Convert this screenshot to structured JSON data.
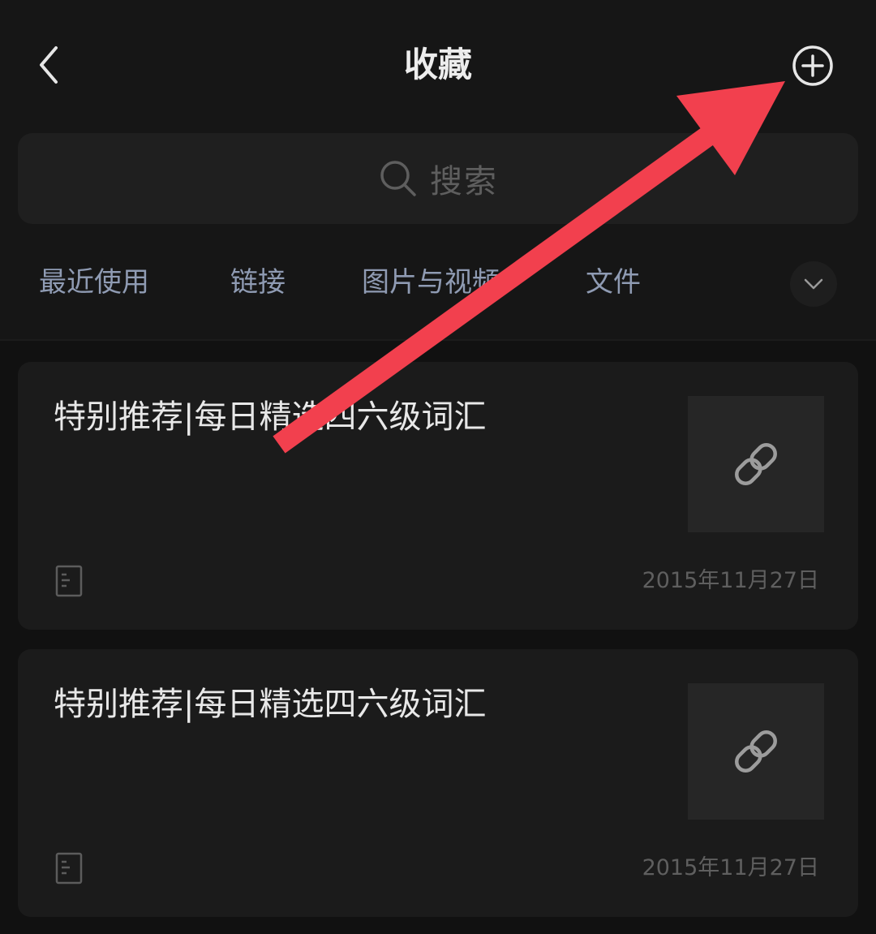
{
  "header": {
    "title": "收藏",
    "back_icon": "chevron-left-icon",
    "add_icon": "plus-circle-icon"
  },
  "search": {
    "placeholder": "搜索",
    "icon": "search-icon"
  },
  "filters": {
    "items": [
      {
        "label": "最近使用"
      },
      {
        "label": "链接"
      },
      {
        "label": "图片与视频"
      },
      {
        "label": "文件"
      }
    ],
    "expand_icon": "chevron-down-icon"
  },
  "cards": [
    {
      "title": "特别推荐|每日精选四六级词汇",
      "date": "2015年11月27日",
      "thumb_icon": "link-icon",
      "type_icon": "document-icon"
    },
    {
      "title": "特别推荐|每日精选四六级词汇",
      "date": "2015年11月27日",
      "thumb_icon": "link-icon",
      "type_icon": "document-icon"
    }
  ],
  "colors": {
    "background": "#111111",
    "card": "#1b1b1b",
    "filter_text": "#8f9bb3",
    "annotation_arrow": "#f2404e"
  }
}
